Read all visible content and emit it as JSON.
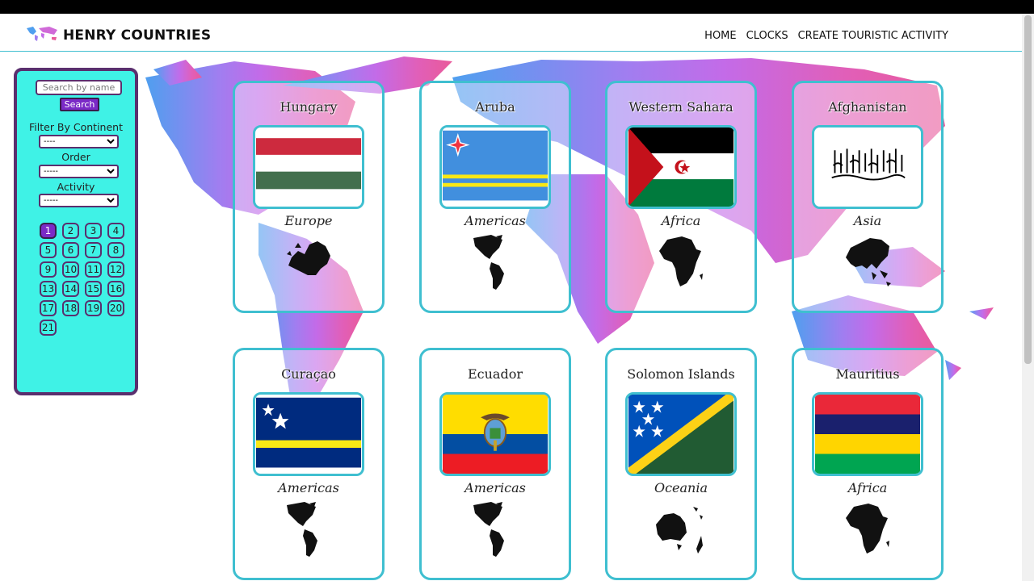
{
  "app": {
    "title": "HENRY COUNTRIES"
  },
  "nav": {
    "home": "HOME",
    "clocks": "CLOCKS",
    "create": "CREATE TOURISTIC ACTIVITY"
  },
  "sidebar": {
    "search_placeholder": "Search by name",
    "search_button": "Search",
    "filter_continent_label": "Filter By Continent",
    "filter_continent_value": "----",
    "order_label": "Order",
    "order_value": "-----",
    "activity_label": "Activity",
    "activity_value": "-----"
  },
  "pagination": {
    "pages": [
      "1",
      "2",
      "3",
      "4",
      "5",
      "6",
      "7",
      "8",
      "9",
      "10",
      "11",
      "12",
      "13",
      "14",
      "15",
      "16",
      "17",
      "18",
      "19",
      "20",
      "21"
    ],
    "current": "1"
  },
  "cards": [
    {
      "name": "Hungary",
      "continent": "Europe",
      "flag": "hungary"
    },
    {
      "name": "Aruba",
      "continent": "Americas",
      "flag": "aruba"
    },
    {
      "name": "Western Sahara",
      "continent": "Africa",
      "flag": "western-sahara"
    },
    {
      "name": "Afghanistan",
      "continent": "Asia",
      "flag": "afghanistan"
    },
    {
      "name": "Curaçao",
      "continent": "Americas",
      "flag": "curacao"
    },
    {
      "name": "Ecuador",
      "continent": "Americas",
      "flag": "ecuador"
    },
    {
      "name": "Solomon Islands",
      "continent": "Oceania",
      "flag": "solomon-islands"
    },
    {
      "name": "Mauritius",
      "continent": "Africa",
      "flag": "mauritius"
    }
  ],
  "colors": {
    "accent": "#3fbfd0",
    "sidebar_bg": "#3ff2e6",
    "sidebar_border": "#5a2f6e",
    "button": "#7b2ac7"
  }
}
